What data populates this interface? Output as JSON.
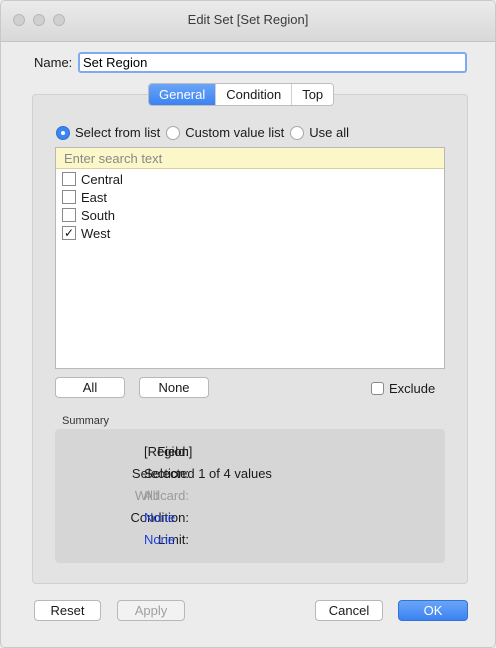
{
  "window": {
    "title": "Edit Set [Set Region]"
  },
  "name": {
    "label": "Name:",
    "value": "Set Region"
  },
  "tabs": [
    {
      "label": "General",
      "active": true
    },
    {
      "label": "Condition",
      "active": false
    },
    {
      "label": "Top",
      "active": false
    }
  ],
  "mode": {
    "options": [
      {
        "label": "Select from list",
        "selected": true
      },
      {
        "label": "Custom value list",
        "selected": false
      },
      {
        "label": "Use all",
        "selected": false
      }
    ]
  },
  "search": {
    "placeholder": "Enter search text"
  },
  "items": [
    {
      "label": "Central",
      "checked": false
    },
    {
      "label": "East",
      "checked": false
    },
    {
      "label": "South",
      "checked": false
    },
    {
      "label": "West",
      "checked": true
    }
  ],
  "list_buttons": {
    "all": "All",
    "none": "None"
  },
  "exclude": {
    "label": "Exclude",
    "checked": false
  },
  "summary": {
    "title": "Summary",
    "rows": [
      {
        "key": "Field:",
        "value": "[Region]"
      },
      {
        "key": "Selection:",
        "value": "Selected 1 of 4 values"
      },
      {
        "key": "Wildcard:",
        "value": "All"
      },
      {
        "key": "Condition:",
        "value": "None"
      },
      {
        "key": "Limit:",
        "value": "None"
      }
    ]
  },
  "footer": {
    "reset": "Reset",
    "apply": "Apply",
    "cancel": "Cancel",
    "ok": "OK"
  },
  "colors": {
    "accent": "#3b82f2",
    "link": "#1f3fd6",
    "search_bg": "#fcf7c8"
  }
}
